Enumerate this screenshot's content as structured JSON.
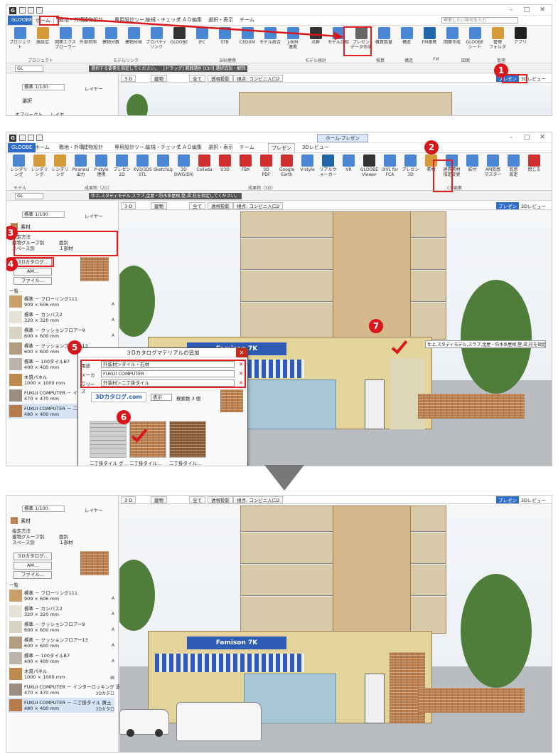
{
  "window": {
    "min": "–",
    "max": "□",
    "close": "✕",
    "app_icon": "G"
  },
  "qat": {
    "icons": [
      "new-file-icon",
      "open-file-icon",
      "save-icon"
    ]
  },
  "menu": {
    "tabs": [
      "GLOOBE",
      "ホーム",
      "敷地・外構",
      "建物設計",
      "専用設計ツール",
      "法規・チェック",
      "ＣＡＤ編集",
      "選択・表示",
      "チーム"
    ],
    "presen_tabs": [
      "GLOOBE",
      "ホーム",
      "敷地・外構",
      "建物設計",
      "専用設計ツール",
      "法規・チェック",
      "ＣＡＤ編集",
      "選択・表示",
      "チーム",
      "プレゼン",
      "3Dレビュー"
    ],
    "context_label": "ホーム-プレゼン",
    "search_placeholder": "検索したい語句を入力"
  },
  "ribbon1": {
    "buttons": [
      {
        "label": "プロジェクト",
        "color": "#4a86d4"
      },
      {
        "label": "施設定",
        "color": "#d59a3a"
      },
      {
        "label": "図面エクス\nプローラー",
        "color": "#4a86d4"
      },
      {
        "label": "外部参照",
        "color": "#4a86d4"
      },
      {
        "label": "建物分散",
        "color": "#4a86d4"
      },
      {
        "label": "建物分岐",
        "color": "#4a86d4"
      },
      {
        "label": "プロパティ\nリンク",
        "color": "#4a86d4"
      },
      {
        "label": "GLOOBE",
        "color": "#333333"
      },
      {
        "label": "IFC",
        "color": "#4a86d4"
      },
      {
        "label": "STB",
        "color": "#4a86d4"
      },
      {
        "label": "CEDXM",
        "color": "#4a86d4"
      },
      {
        "label": "モデル統合",
        "color": "#4a86d4"
      },
      {
        "label": "J-BIM\n連携",
        "color": "#4a86d4"
      },
      {
        "label": "点群",
        "color": "#333333"
      },
      {
        "label": "モデル比較",
        "color": "#4a86d4"
      },
      {
        "label": "プレゼン\nデータ作成",
        "color": "#666666"
      },
      {
        "label": "概算数量",
        "color": "#4a86d4"
      },
      {
        "label": "構造",
        "color": "#4a86d4"
      },
      {
        "label": "FM連携",
        "color": "#2266aa"
      },
      {
        "label": "図面作成",
        "color": "#4a86d4"
      },
      {
        "label": "GLOOBE\nシート",
        "color": "#4a86d4"
      },
      {
        "label": "管理\nフォルダ",
        "color": "#d59a3a"
      },
      {
        "label": "アプリ",
        "color": "#222222"
      }
    ],
    "groups": [
      "プロジェクト",
      "モデルリンク",
      "BIM連携",
      "モデル検討",
      "積算",
      "構造",
      "FM",
      "図面",
      "管理"
    ]
  },
  "ribbon2": {
    "buttons": [
      {
        "label": "レンダリング\n確認",
        "color": "#4a86d4"
      },
      {
        "label": "レンダリング\n画像",
        "color": "#d59a3a"
      },
      {
        "label": "レンダリング\nファクトリー",
        "color": "#d59a3a"
      },
      {
        "label": "Piranesi\n出力",
        "color": "#4a86d4"
      },
      {
        "label": "P-style\n連携",
        "color": "#4a86d4"
      },
      {
        "label": "プレゼン\n2D",
        "color": "#4a86d4"
      },
      {
        "label": "XV3/3DS\nSTL",
        "color": "#4a86d4"
      },
      {
        "label": "SketchUp",
        "color": "#4a86d4"
      },
      {
        "label": "3D\nDWG/DXF",
        "color": "#4a86d4"
      },
      {
        "label": "Collada",
        "color": "#d03030"
      },
      {
        "label": "U3D",
        "color": "#d03030"
      },
      {
        "label": "FBX",
        "color": "#d03030"
      },
      {
        "label": "3D\nPDF",
        "color": "#d03030"
      },
      {
        "label": "Google\nEarth",
        "color": "#d03030"
      },
      {
        "label": "V-style",
        "color": "#4a86d4"
      },
      {
        "label": "リアルウォーカー\n連携",
        "color": "#2266aa"
      },
      {
        "label": "VR",
        "color": "#4a86d4"
      },
      {
        "label": "GLOOBE\nViewer",
        "color": "#333333"
      },
      {
        "label": "iXVL for FCA",
        "color": "#4a86d4"
      },
      {
        "label": "プレゼン3D",
        "color": "#4a86d4"
      },
      {
        "label": "素材",
        "color": "#d59a3a"
      },
      {
        "label": "建具素材\n指定変更",
        "color": "#4a86d4"
      },
      {
        "label": "影付",
        "color": "#4a86d4"
      },
      {
        "label": "AM質感\nマスター",
        "color": "#4a86d4"
      },
      {
        "label": "質感\n設定",
        "color": "#4a86d4"
      },
      {
        "label": "閉じる",
        "color": "#d03030"
      }
    ],
    "groups": [
      "モデル",
      "成果物（2D）",
      "成果物（3D）",
      "CG編集"
    ]
  },
  "toolbar": {
    "layer": "GL",
    "hint1": "選択する要素を指定してください。",
    "hint2": "[ドラッグ] 範囲選択",
    "hint3": "[Ctrl] 選択追加・解除",
    "hint_material": "仕上,スタディモデル,スラブ,金屋・防水系屋根,壁,梁,柱を指定してください。",
    "scale": "標準 1/100",
    "layer_btn": "レイヤー",
    "presen": "プレゼン",
    "review": "3Dレビュー"
  },
  "view": {
    "tab_3d": "3 D",
    "tab_building": "建物",
    "tab_all": "全て",
    "tab_persp": "透視投影",
    "tab_viewpoint": "視点: コンビニ入口2"
  },
  "panel1": {
    "title": "選択",
    "opt1": "オブジェクト",
    "opt2": "レイヤ"
  },
  "material_panel": {
    "title": "素材",
    "method_label": "指定方法",
    "opt_group": "建物グループ別",
    "opt_space": "スペース別",
    "opt_face": "面別",
    "opt_part": "１部材",
    "btn_catalog": "３Dカタログ...",
    "btn_am": "AM...",
    "btn_file": "ファイル...",
    "list_label": "一覧"
  },
  "material_list": [
    {
      "name": "標準 － フローリング111",
      "size": "909 × 606 mm",
      "tag": "A",
      "color": "#c9a06a"
    },
    {
      "name": "標準 － カンバス2",
      "size": "320 × 320 mm",
      "tag": "A",
      "color": "#e7e2d8"
    },
    {
      "name": "標準 － クッションフロアー9",
      "size": "600 × 600 mm",
      "tag": "A",
      "color": "#d9d3c4"
    },
    {
      "name": "標準 － クッションフロアー13",
      "size": "600 × 600 mm",
      "tag": "A",
      "color": "#b39c80"
    },
    {
      "name": "標準 － 100タイルB7",
      "size": "400 × 400 mm",
      "tag": "A",
      "color": "#bcb4a8"
    },
    {
      "name": "木質パネル",
      "size": "1000 × 1000 mm",
      "tag": "画",
      "color": "#c08a4d"
    },
    {
      "name": "FUKUI COMPUTER － インターロッキング 黒",
      "size": "470 × 470 mm",
      "tag": "3Dカタロ",
      "color": "#9b8d80"
    },
    {
      "name": "FUKUI COMPUTER － 二丁掛タイル 黄土",
      "size": "480 × 400 mm",
      "tag": "3Dカタロ",
      "color": "#b87c4a"
    }
  ],
  "dialog": {
    "title": "３Dカタログマテリアルの追加",
    "close": "✕",
    "use_label": "用途",
    "use_value": "外装材＞タイル・石材",
    "maker_label": "メーカー",
    "maker_value": "FUKUI COMPUTER",
    "series_label": "シリーズ",
    "series_value": "外装材＞二丁掛タイル",
    "logo": "3Dカタログ.com",
    "display_label": "表示",
    "count_label": "検索数 3 個",
    "items": [
      {
        "label": "二丁掛タイル グ…",
        "color": "#bdbdbd"
      },
      {
        "label": "二丁掛タイル…",
        "color": "#b07a48"
      },
      {
        "label": "二丁掛タイル…",
        "color": "#8a5a34"
      }
    ]
  },
  "scene": {
    "store_sign": "Famison 7K",
    "store_sign2": "Famison 7K"
  },
  "steps": [
    "1",
    "2",
    "3",
    "4",
    "5",
    "6",
    "7"
  ]
}
